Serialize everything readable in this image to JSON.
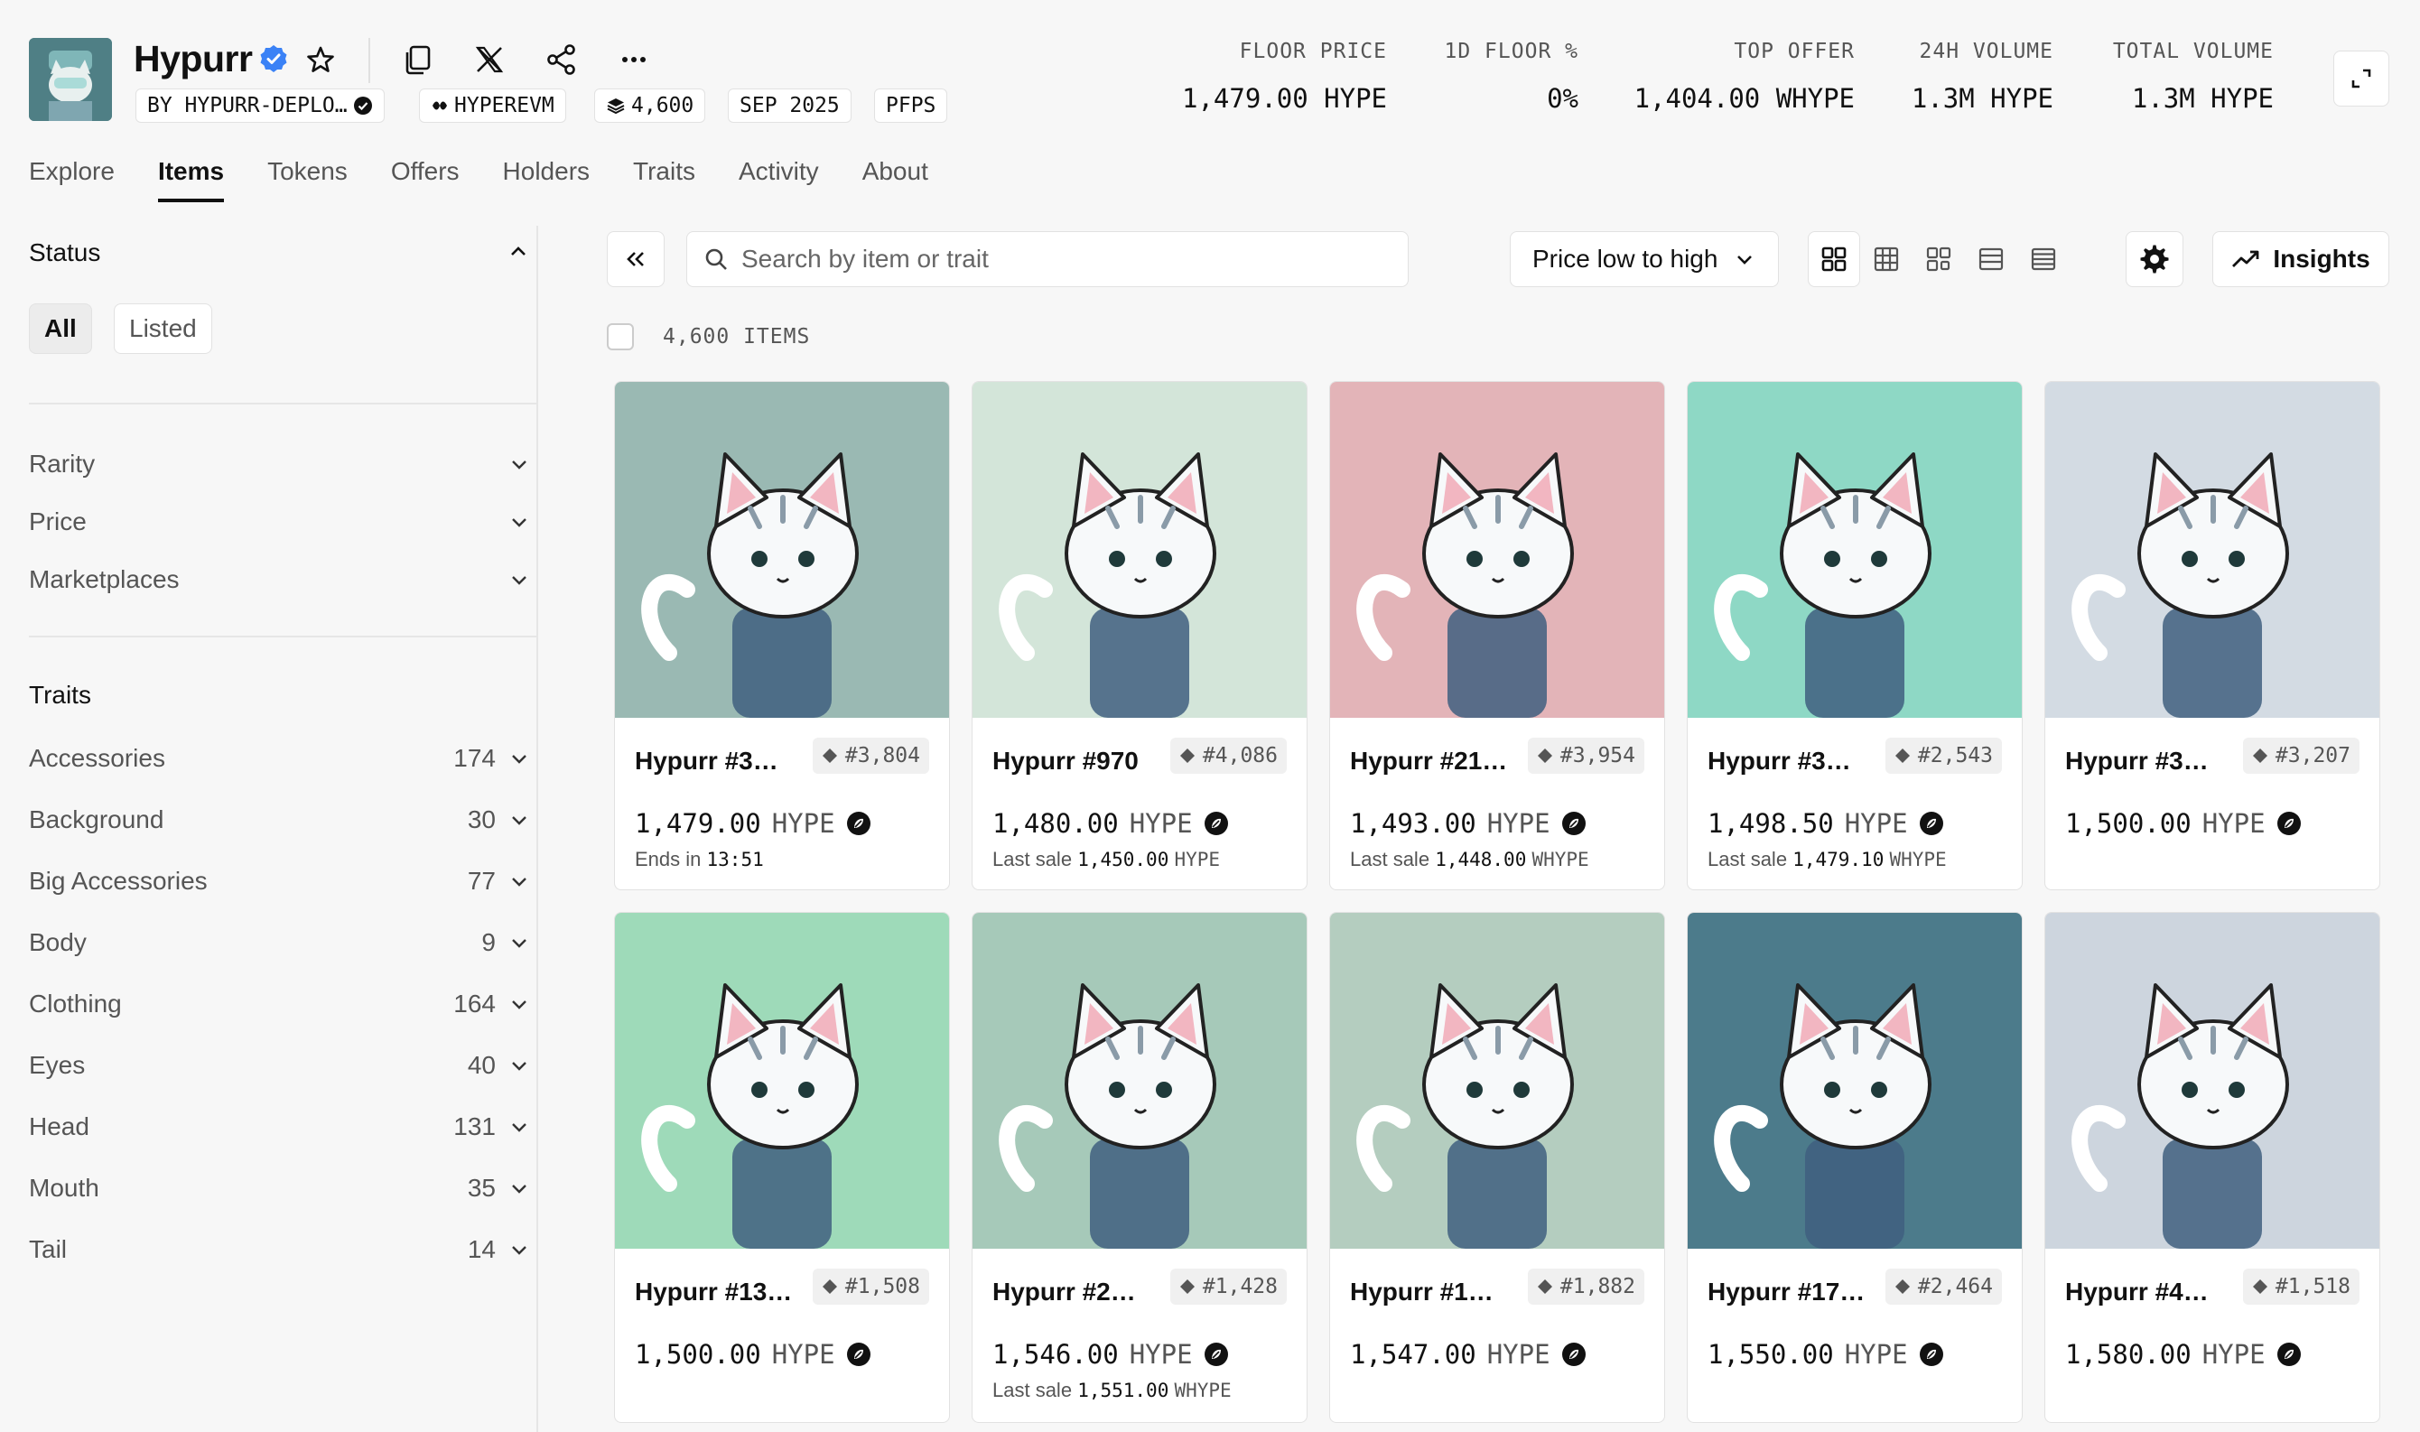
{
  "collection": {
    "title": "Hypurr",
    "creator": "BY HYPURR-DEPLO…",
    "chain": "HYPEREVM",
    "supply": "4,600",
    "date": "SEP 2025",
    "category": "PFPS"
  },
  "stats": [
    {
      "label": "FLOOR PRICE",
      "value": "1,479.00 HYPE"
    },
    {
      "label": "1D FLOOR %",
      "value": "0%"
    },
    {
      "label": "TOP OFFER",
      "value": "1,404.00 WHYPE"
    },
    {
      "label": "24H VOLUME",
      "value": "1.3M HYPE"
    },
    {
      "label": "TOTAL VOLUME",
      "value": "1.3M HYPE"
    }
  ],
  "tabs": [
    "Explore",
    "Items",
    "Tokens",
    "Offers",
    "Holders",
    "Traits",
    "Activity",
    "About"
  ],
  "sidebar": {
    "status_title": "Status",
    "status_options": [
      "All",
      "Listed"
    ],
    "filters": [
      "Rarity",
      "Price",
      "Marketplaces"
    ],
    "traits_title": "Traits",
    "traits": [
      {
        "name": "Accessories",
        "count": "174"
      },
      {
        "name": "Background",
        "count": "30"
      },
      {
        "name": "Big Accessories",
        "count": "77"
      },
      {
        "name": "Body",
        "count": "9"
      },
      {
        "name": "Clothing",
        "count": "164"
      },
      {
        "name": "Eyes",
        "count": "40"
      },
      {
        "name": "Head",
        "count": "131"
      },
      {
        "name": "Mouth",
        "count": "35"
      },
      {
        "name": "Tail",
        "count": "14"
      }
    ]
  },
  "toolbar": {
    "search_placeholder": "Search by item or trait",
    "sort_label": "Price low to high",
    "insights_label": "Insights"
  },
  "items_count": "4,600 ITEMS",
  "items": [
    {
      "name": "Hypurr #3…",
      "rank": "#3,804",
      "price": "1,479.00",
      "unit": "HYPE",
      "sub_prefix": "Ends in",
      "sub_value": "13:51",
      "sub_cur": "",
      "bg": "#9ab9b3"
    },
    {
      "name": "Hypurr #970",
      "rank": "#4,086",
      "price": "1,480.00",
      "unit": "HYPE",
      "sub_prefix": "Last sale",
      "sub_value": "1,450.00",
      "sub_cur": "HYPE",
      "bg": "#d3e5d9"
    },
    {
      "name": "Hypurr #21…",
      "rank": "#3,954",
      "price": "1,493.00",
      "unit": "HYPE",
      "sub_prefix": "Last sale",
      "sub_value": "1,448.00",
      "sub_cur": "WHYPE",
      "bg": "#e3b4b8"
    },
    {
      "name": "Hypurr #3…",
      "rank": "#2,543",
      "price": "1,498.50",
      "unit": "HYPE",
      "sub_prefix": "Last sale",
      "sub_value": "1,479.10",
      "sub_cur": "WHYPE",
      "bg": "#8ed8c5"
    },
    {
      "name": "Hypurr #3…",
      "rank": "#3,207",
      "price": "1,500.00",
      "unit": "HYPE",
      "sub_prefix": "",
      "sub_value": "",
      "sub_cur": "",
      "bg": "#d3dbe3"
    },
    {
      "name": "Hypurr #13…",
      "rank": "#1,508",
      "price": "1,500.00",
      "unit": "HYPE",
      "sub_prefix": "",
      "sub_value": "",
      "sub_cur": "",
      "bg": "#9edab9"
    },
    {
      "name": "Hypurr #2…",
      "rank": "#1,428",
      "price": "1,546.00",
      "unit": "HYPE",
      "sub_prefix": "Last sale",
      "sub_value": "1,551.00",
      "sub_cur": "WHYPE",
      "bg": "#a6c9b9"
    },
    {
      "name": "Hypurr #1…",
      "rank": "#1,882",
      "price": "1,547.00",
      "unit": "HYPE",
      "sub_prefix": "",
      "sub_value": "",
      "sub_cur": "",
      "bg": "#b4cdbf"
    },
    {
      "name": "Hypurr #17…",
      "rank": "#2,464",
      "price": "1,550.00",
      "unit": "HYPE",
      "sub_prefix": "",
      "sub_value": "",
      "sub_cur": "",
      "bg": "#4c7b8b"
    },
    {
      "name": "Hypurr #4…",
      "rank": "#1,518",
      "price": "1,580.00",
      "unit": "HYPE",
      "sub_prefix": "",
      "sub_value": "",
      "sub_cur": "",
      "bg": "#cdd5de"
    }
  ]
}
